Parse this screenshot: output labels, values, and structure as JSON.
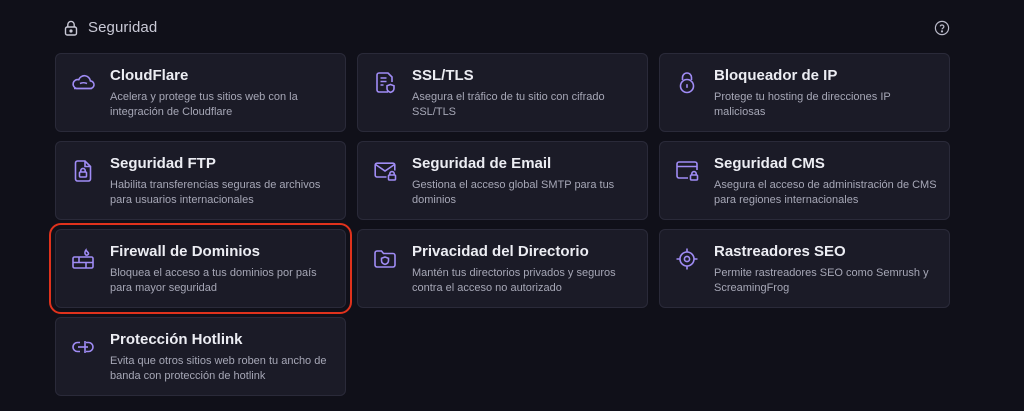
{
  "section": {
    "title": "Seguridad"
  },
  "cards": [
    {
      "id": "cloudflare",
      "title": "CloudFlare",
      "desc": "Acelera y protege tus sitios web con la integración de Cloudflare"
    },
    {
      "id": "ssl",
      "title": "SSL/TLS",
      "desc": "Asegura el tráfico de tu sitio con cifrado SSL/TLS"
    },
    {
      "id": "ip-blocker",
      "title": "Bloqueador de IP",
      "desc": "Protege tu hosting de direcciones IP maliciosas"
    },
    {
      "id": "ftp",
      "title": "Seguridad FTP",
      "desc": "Habilita transferencias seguras de archivos para usuarios internacionales"
    },
    {
      "id": "email",
      "title": "Seguridad de Email",
      "desc": "Gestiona el acceso global SMTP para tus dominios"
    },
    {
      "id": "cms",
      "title": "Seguridad CMS",
      "desc": "Asegura el acceso de administración de CMS para regiones internacionales"
    },
    {
      "id": "firewall",
      "title": "Firewall de Dominios",
      "desc": "Bloquea el acceso a tus dominios por país para mayor seguridad"
    },
    {
      "id": "directory",
      "title": "Privacidad del Directorio",
      "desc": "Mantén tus directorios privados y seguros contra el acceso no autorizado"
    },
    {
      "id": "seo-crawlers",
      "title": "Rastreadores SEO",
      "desc": "Permite rastreadores SEO como Semrush y ScreamingFrog"
    },
    {
      "id": "hotlink",
      "title": "Protección Hotlink",
      "desc": "Evita que otros sitios web roben tu ancho de banda con protección de hotlink"
    }
  ],
  "highlighted_card": "firewall",
  "colors": {
    "background": "#101019",
    "card_background": "#1b1b27",
    "icon_accent": "#a08cf5",
    "highlight": "#e0321c"
  }
}
